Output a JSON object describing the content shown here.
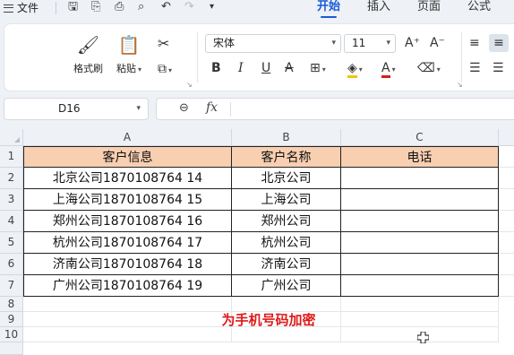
{
  "menu": {
    "file_label": "文件",
    "tabs": [
      {
        "label": "开始",
        "active": true
      },
      {
        "label": "插入",
        "active": false
      },
      {
        "label": "页面",
        "active": false
      },
      {
        "label": "公式",
        "active": false
      }
    ]
  },
  "ribbon": {
    "format_painter_label": "格式刷",
    "paste_label": "粘贴",
    "font_name": "宋体",
    "font_size": "11",
    "font_grow": "A⁺",
    "font_shrink": "A⁻",
    "bold": "B",
    "italic": "I",
    "underline": "U",
    "strike": "A"
  },
  "formula_bar": {
    "name_box": "D16",
    "fx_label": "fx",
    "formula": ""
  },
  "sheet": {
    "columns": [
      "A",
      "B",
      "C"
    ],
    "rows": [
      "1",
      "2",
      "3",
      "4",
      "5",
      "6",
      "7",
      "8",
      "9",
      "10"
    ],
    "header": [
      "客户信息",
      "客户名称",
      "电话"
    ],
    "data": [
      [
        "北京公司1870108764 14",
        "北京公司",
        ""
      ],
      [
        "上海公司1870108764 15",
        "上海公司",
        ""
      ],
      [
        "郑州公司1870108764 16",
        "郑州公司",
        ""
      ],
      [
        "杭州公司1870108764 17",
        "杭州公司",
        ""
      ],
      [
        "济南公司1870108764 18",
        "济南公司",
        ""
      ],
      [
        "广州公司1870108764 19",
        "广州公司",
        ""
      ]
    ],
    "note": "为手机号码加密",
    "header_fill": "#f8cfb1",
    "note_color": "#e01a1a"
  }
}
